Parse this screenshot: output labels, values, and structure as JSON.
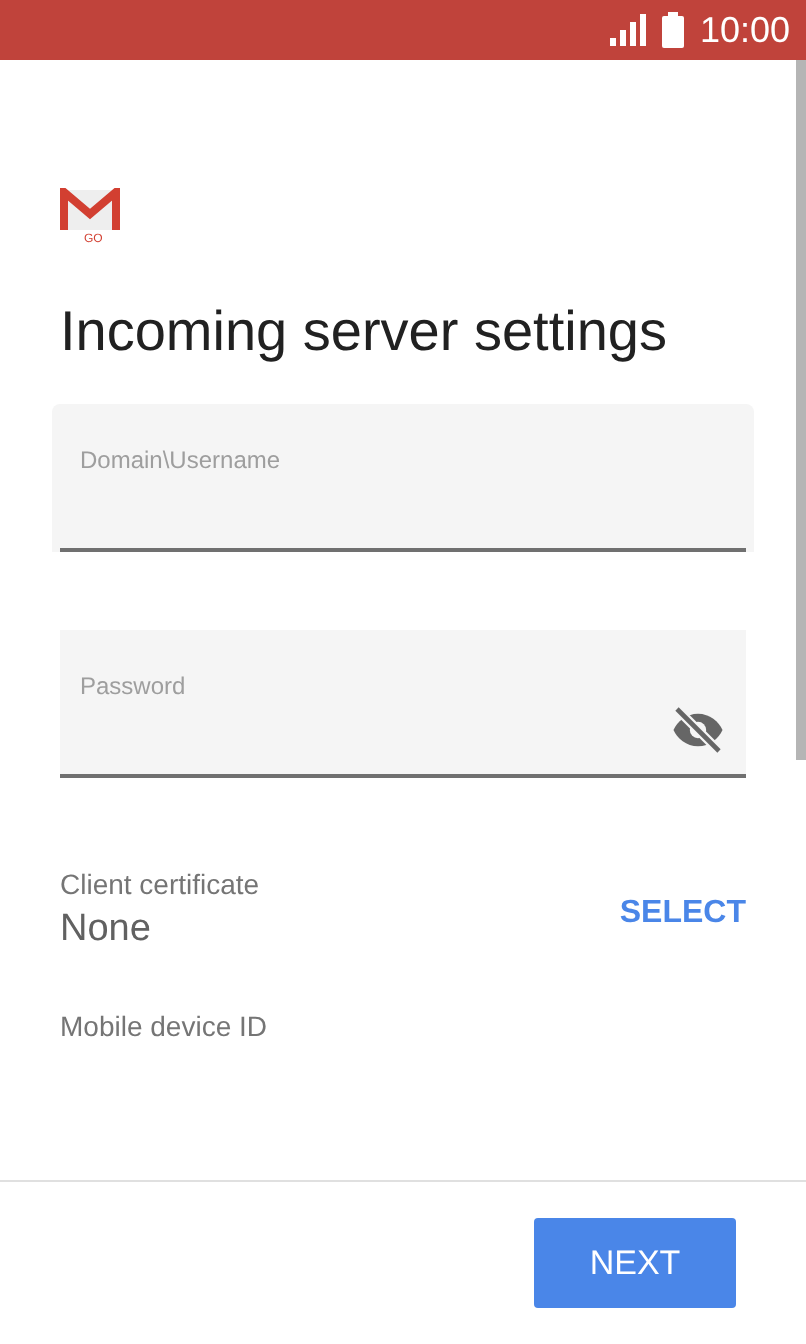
{
  "status_bar": {
    "time": "10:00"
  },
  "logo": {
    "text": "GO"
  },
  "title": "Incoming server settings",
  "fields": [
    {
      "kind": "text",
      "label": "Domain\\Username"
    },
    {
      "kind": "password",
      "label": "Password",
      "password_visible": false
    }
  ],
  "client_certificate": {
    "label": "Client certificate",
    "value": "None",
    "action": "SELECT"
  },
  "mobile_device_id": {
    "label": "Mobile device ID"
  },
  "buttons": [
    "NEXT"
  ]
}
